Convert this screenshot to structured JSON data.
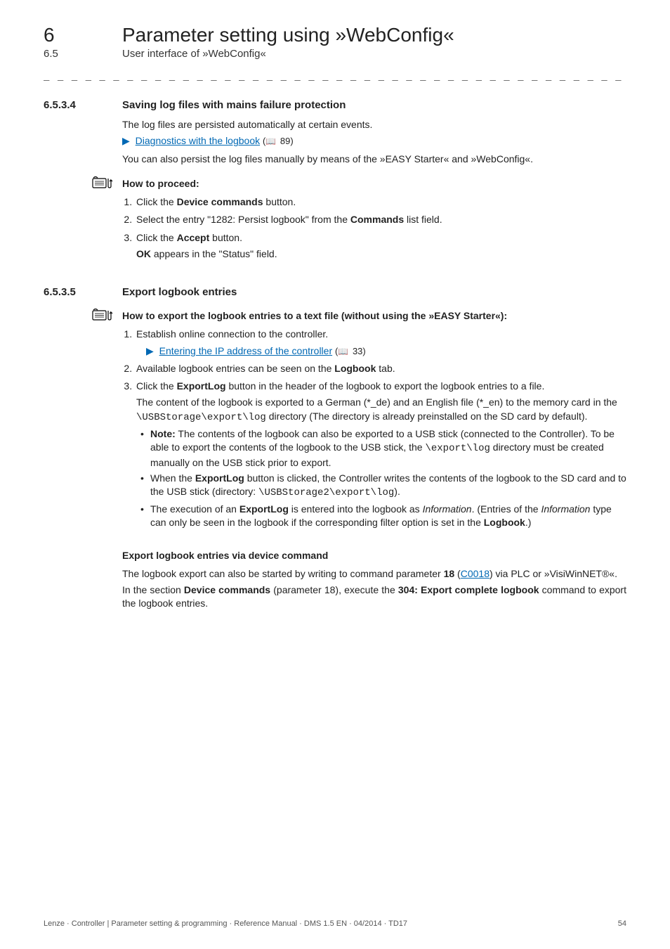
{
  "header": {
    "chapter_num": "6",
    "chapter_title": "Parameter setting using »WebConfig«",
    "sub_num": "6.5",
    "sub_title": "User interface of »WebConfig«"
  },
  "dash_rule": "_ _ _ _ _ _ _ _ _ _ _ _ _ _ _ _ _ _ _ _ _ _ _ _ _ _ _ _ _ _ _ _ _ _ _ _ _ _ _ _ _ _ _ _ _ _ _ _ _ _ _ _ _ _ _ _ _ _ _ _ _ _ _ _",
  "sec1": {
    "num": "6.5.3.4",
    "title": "Saving log files with mains failure protection",
    "p1": "The log files are persisted automatically at certain events.",
    "link1_text": "Diagnostics with the logbook",
    "link1_ref": "89",
    "p2": "You can also persist the log files manually by means of the »EASY Starter« and »WebConfig«.",
    "proc_label": "How to proceed:",
    "steps": {
      "s1_a": "Click the ",
      "s1_b": "Device commands",
      "s1_c": " button.",
      "s2_a": "Select the entry \"1282: Persist logbook\" from the ",
      "s2_b": "Commands",
      "s2_c": " list field.",
      "s3_a": "Click the ",
      "s3_b": "Accept",
      "s3_c": " button.",
      "s3_after_a": "OK",
      "s3_after_b": " appears in the \"Status\" field."
    }
  },
  "sec2": {
    "num": "6.5.3.5",
    "title": "Export logbook entries",
    "proc_label": "How to export the logbook entries to a text file (without using the »EASY Starter«):",
    "steps": {
      "s1": "Establish online connection to the controller.",
      "s1_link_text": "Entering the IP address of the controller",
      "s1_link_ref": "33",
      "s2_a": "Available logbook entries can be seen on the ",
      "s2_b": "Logbook",
      "s2_c": " tab.",
      "s3_a": "Click the ",
      "s3_b": "ExportLog",
      "s3_c": " button in the header of the logbook to export the logbook entries to a file.",
      "s3_p_a": "The content of the logbook is exported to a German (*_de) and an English file (*_en) to the memory card in the ",
      "s3_p_code1": "\\USBStorage\\export\\log",
      "s3_p_b": " directory (The directory is already preinstalled on the SD card by default).",
      "b1_a": "Note:",
      "b1_b": " The contents of the logbook can also be exported to a USB stick (connected to the Controller). To be able to export the contents of the logbook to the USB stick, the ",
      "b1_code": "\\export\\log",
      "b1_c": " directory must be created manually on the USB stick prior to export.",
      "b2_a": "When the ",
      "b2_b": "ExportLog",
      "b2_c": " button is clicked, the Controller writes the contents of the logbook to the SD card and to the USB stick (directory: ",
      "b2_code": "\\USBStorage2\\export\\log",
      "b2_d": ").",
      "b3_a": "The execution of an ",
      "b3_b": "ExportLog",
      "b3_c": " is entered into the logbook as ",
      "b3_d": "Information",
      "b3_e": ". (Entries of the ",
      "b3_f": "Information",
      "b3_g": " type can only be seen in the logbook if the corresponding filter option is set in the ",
      "b3_h": "Logbook",
      "b3_i": ".)"
    },
    "subhead": "Export logbook entries via device command",
    "dc_p1_a": "The logbook export can also be started by writing to command parameter ",
    "dc_p1_b": "18",
    "dc_p1_c": " (",
    "dc_p1_link": "C0018",
    "dc_p1_d": ") via PLC or »VisiWinNET®«.",
    "dc_p2_a": "In the section ",
    "dc_p2_b": "Device commands",
    "dc_p2_c": " (parameter 18), execute the ",
    "dc_p2_d": "304: Export complete logbook",
    "dc_p2_e": " command to export the logbook entries."
  },
  "footer": {
    "left": "Lenze · Controller | Parameter setting & programming · Reference Manual · DMS 1.5 EN · 04/2014 · TD17",
    "right": "54"
  },
  "icons": {
    "book": "📖"
  }
}
